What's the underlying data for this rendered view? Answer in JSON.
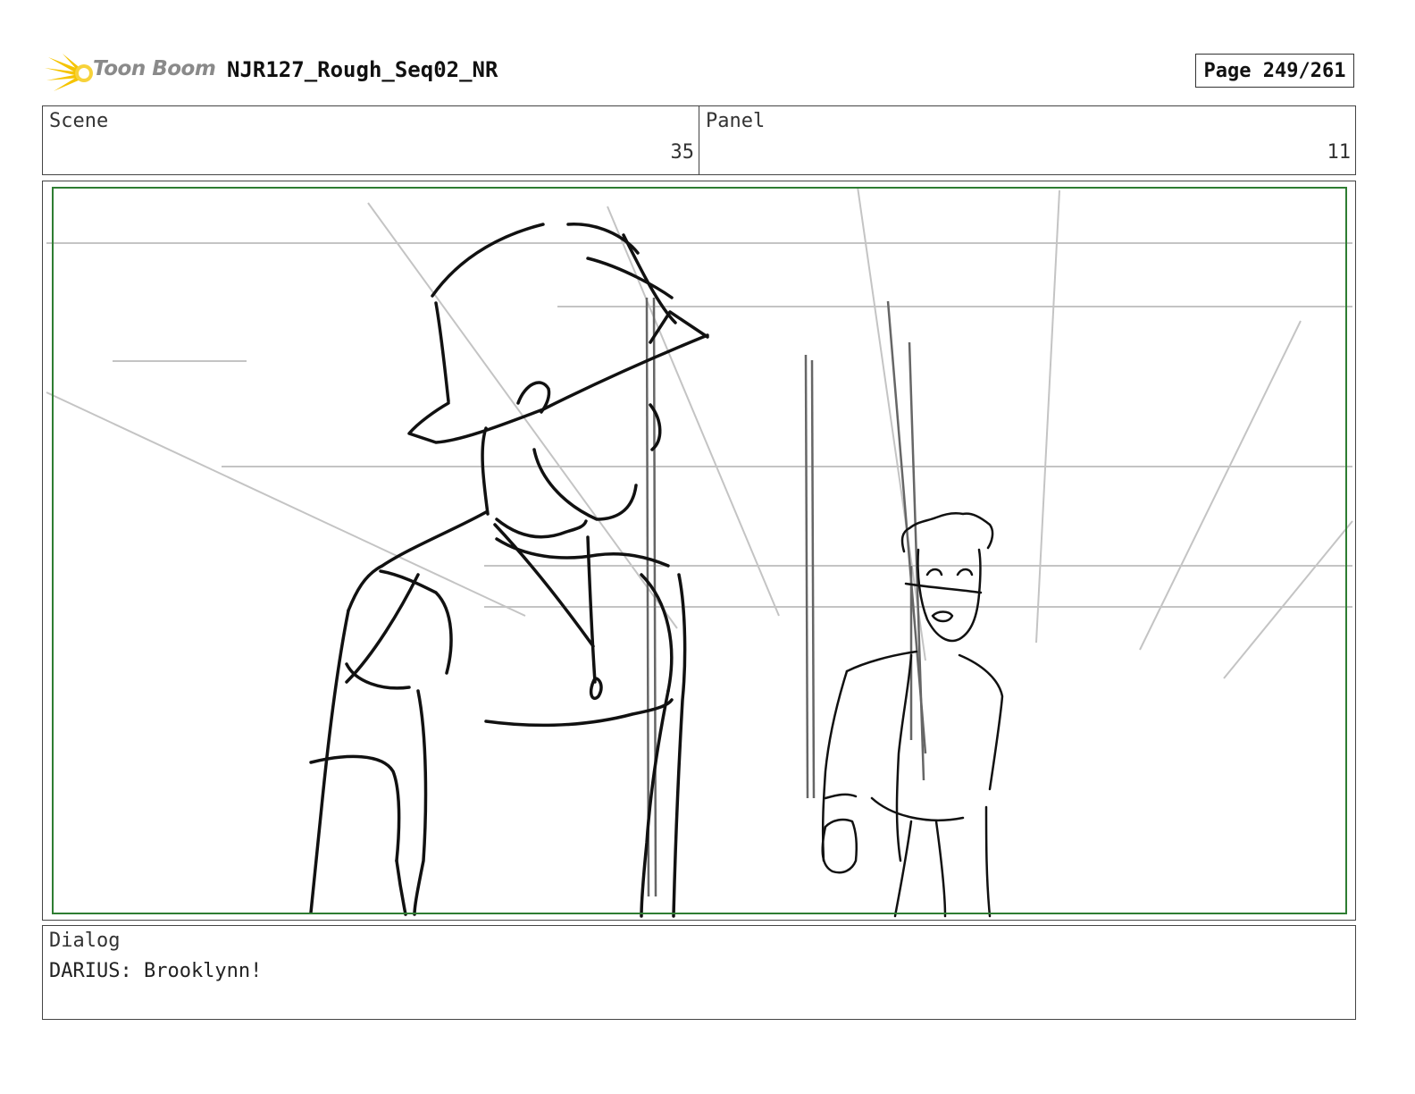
{
  "header": {
    "brand": "Toon Boom",
    "title": "NJR127_Rough_Seq02_NR",
    "page_label": "Page 249/261"
  },
  "info": {
    "scene_label": "Scene",
    "scene_value": "35",
    "panel_label": "Panel",
    "panel_value": "11"
  },
  "dialog": {
    "label": "Dialog",
    "text": "DARIUS: Brooklynn!"
  },
  "colors": {
    "safe_frame": "#2e7d32",
    "guide_lines": "#c4c4c4",
    "ink": "#111111",
    "logo_accent": "#f5c400"
  }
}
